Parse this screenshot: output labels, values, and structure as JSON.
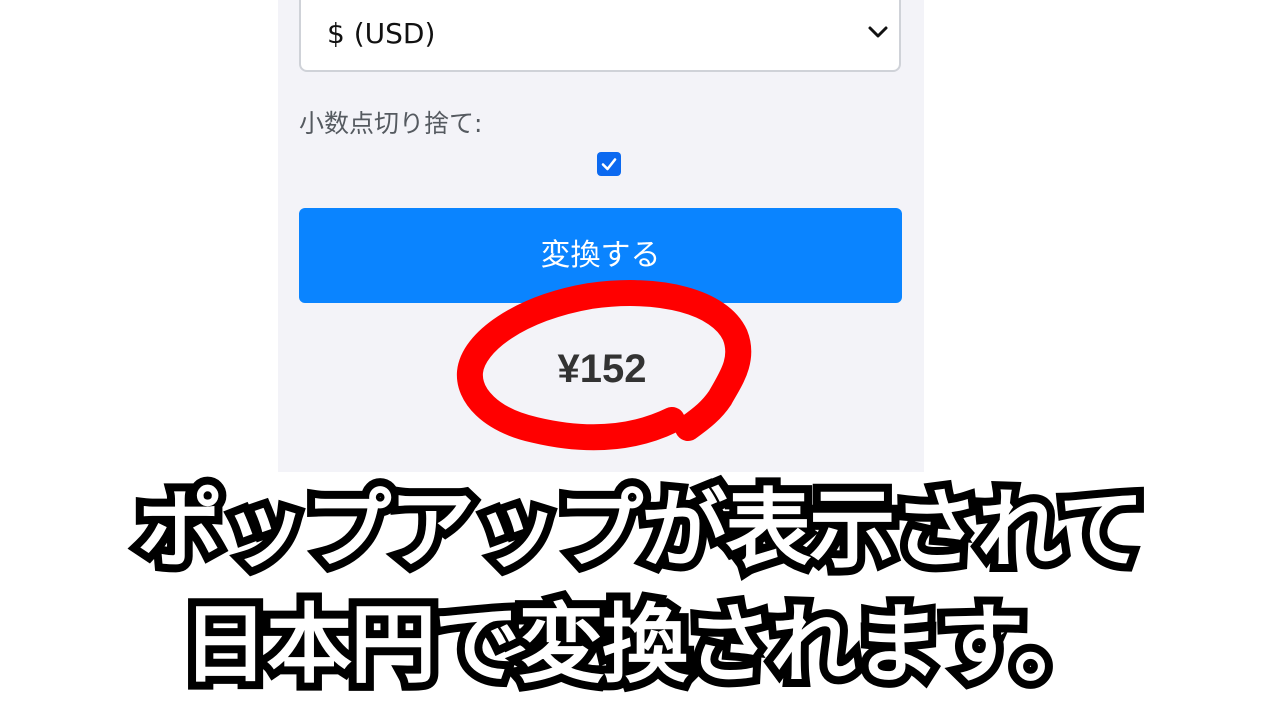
{
  "currency_select": {
    "value": "$ (USD)",
    "chevron_icon": "chevron-down-icon"
  },
  "rounding": {
    "label": "小数点切り捨て:",
    "checked": true
  },
  "convert_button": {
    "label": "変換する",
    "color": "#0a84ff"
  },
  "result": {
    "value": "¥152",
    "highlight_color": "#ff0000"
  },
  "caption": {
    "line1": "ポップアップが表示されて",
    "line2": "日本円で変換されます。"
  }
}
